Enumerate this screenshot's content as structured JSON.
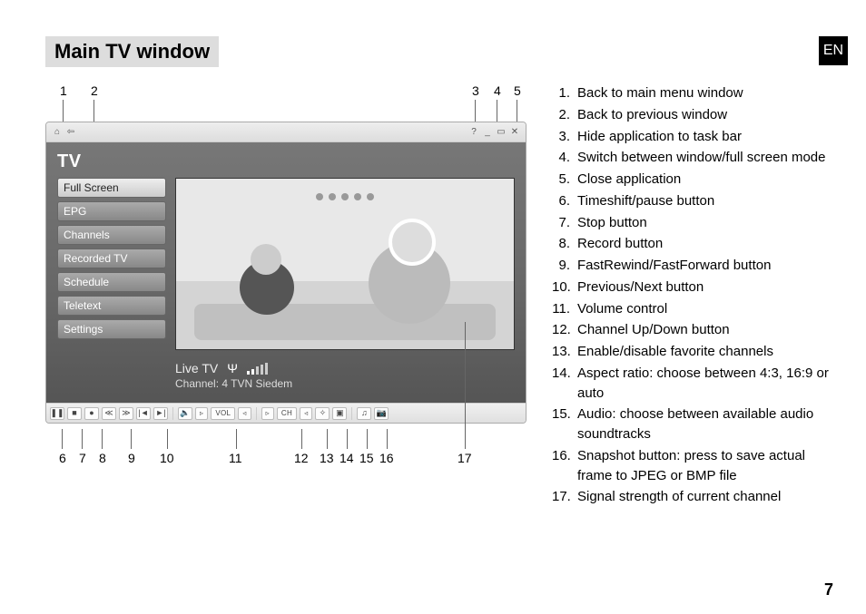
{
  "heading": "Main TV window",
  "lang": "EN",
  "page_number": "7",
  "top_callouts": {
    "c1": "1",
    "c2": "2",
    "c3": "3",
    "c4": "4",
    "c5": "5"
  },
  "bottom_callouts": {
    "c6": "6",
    "c7": "7",
    "c8": "8",
    "c9": "9",
    "c10": "10",
    "c11": "11",
    "c12": "12",
    "c13": "13",
    "c14": "14",
    "c15": "15",
    "c16": "16",
    "c17": "17"
  },
  "app": {
    "tv_title": "TV",
    "menu": {
      "full_screen": "Full Screen",
      "epg": "EPG",
      "channels": "Channels",
      "recorded": "Recorded TV",
      "schedule": "Schedule",
      "teletext": "Teletext",
      "settings": "Settings"
    },
    "status": {
      "live_label": "Live TV",
      "channel_line": "Channel: 4 TVN Siedem"
    },
    "toolbar": {
      "vol_label": "VOL",
      "ch_label": "CH"
    }
  },
  "legend": [
    {
      "n": "1.",
      "t": "Back to main menu window"
    },
    {
      "n": "2.",
      "t": "Back to previous window"
    },
    {
      "n": "3.",
      "t": "Hide application to task bar"
    },
    {
      "n": "4.",
      "t": "Switch between window/full screen mode"
    },
    {
      "n": "5.",
      "t": "Close application"
    },
    {
      "n": "6.",
      "t": "Timeshift/pause button"
    },
    {
      "n": "7.",
      "t": "Stop button"
    },
    {
      "n": "8.",
      "t": "Record button"
    },
    {
      "n": "9.",
      "t": "FastRewind/FastForward button"
    },
    {
      "n": "10.",
      "t": "Previous/Next button"
    },
    {
      "n": "11.",
      "t": "Volume control"
    },
    {
      "n": "12.",
      "t": "Channel Up/Down button"
    },
    {
      "n": "13.",
      "t": "Enable/disable favorite channels"
    },
    {
      "n": "14.",
      "t": "Aspect ratio: choose between 4:3, 16:9 or auto"
    },
    {
      "n": "15.",
      "t": "Audio: choose between available audio soundtracks"
    },
    {
      "n": "16.",
      "t": "Snapshot button: press to save actual frame to JPEG or BMP file"
    },
    {
      "n": "17.",
      "t": "Signal strength of current channel"
    }
  ]
}
